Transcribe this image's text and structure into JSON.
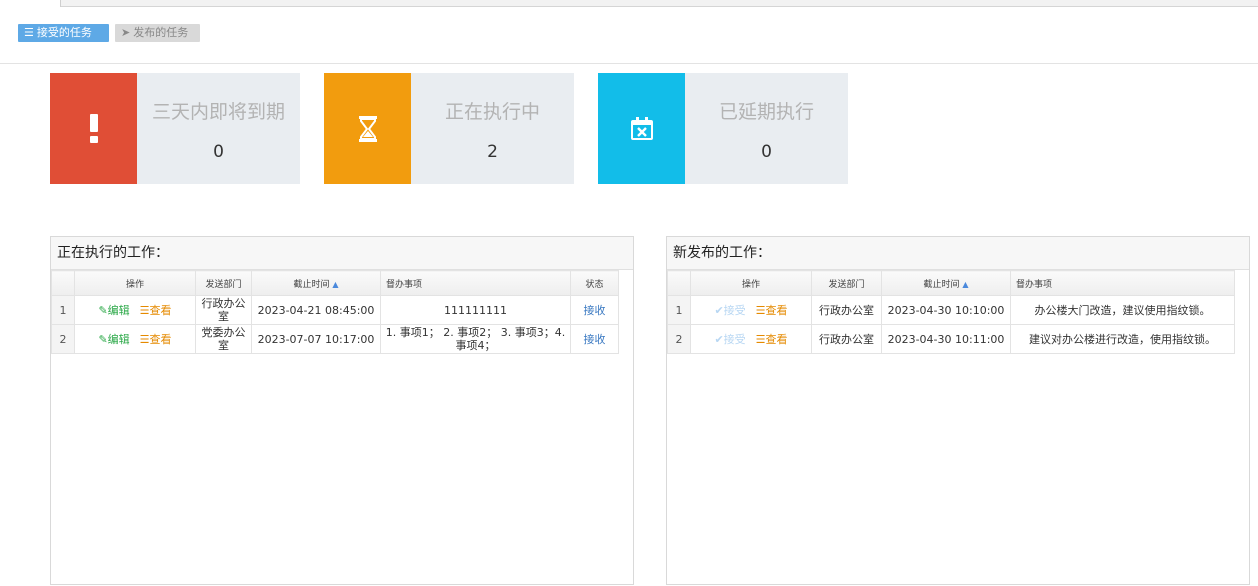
{
  "toolbar": {
    "accept_label": "接受的任务",
    "publish_label": "发布的任务"
  },
  "stats": [
    {
      "label": "三天内即将到期",
      "count": "0",
      "color": "#e04e36",
      "icon": "exclamation-icon"
    },
    {
      "label": "正在执行中",
      "count": "2",
      "color": "#f29c0e",
      "icon": "hourglass-icon"
    },
    {
      "label": "已延期执行",
      "count": "0",
      "color": "#12bde9",
      "icon": "calendar-x-icon"
    }
  ],
  "left_panel": {
    "title": "正在执行的工作：",
    "columns": [
      "操作",
      "发送部门",
      "截止时间",
      "督办事项",
      "状态"
    ],
    "rows": [
      {
        "num": "1",
        "edit": "编辑",
        "view": "查看",
        "dept": "行政办公室",
        "deadline": "2023-04-21 08:45:00",
        "item": "111111111",
        "status": "接收"
      },
      {
        "num": "2",
        "edit": "编辑",
        "view": "查看",
        "dept": "党委办公室",
        "deadline": "2023-07-07 10:17:00",
        "item": "1. 事项1；  2. 事项2；  3. 事项3；4. 事项4；",
        "status": "接收"
      }
    ]
  },
  "right_panel": {
    "title": "新发布的工作：",
    "columns": [
      "操作",
      "发送部门",
      "截止时间",
      "督办事项"
    ],
    "rows": [
      {
        "num": "1",
        "accept": "接受",
        "view": "查看",
        "dept": "行政办公室",
        "deadline": "2023-04-30 10:10:00",
        "item": "办公楼大门改造，建议使用指纹锁。"
      },
      {
        "num": "2",
        "accept": "接受",
        "view": "查看",
        "dept": "行政办公室",
        "deadline": "2023-04-30 10:11:00",
        "item": "建议对办公楼进行改造，使用指纹锁。"
      }
    ]
  }
}
